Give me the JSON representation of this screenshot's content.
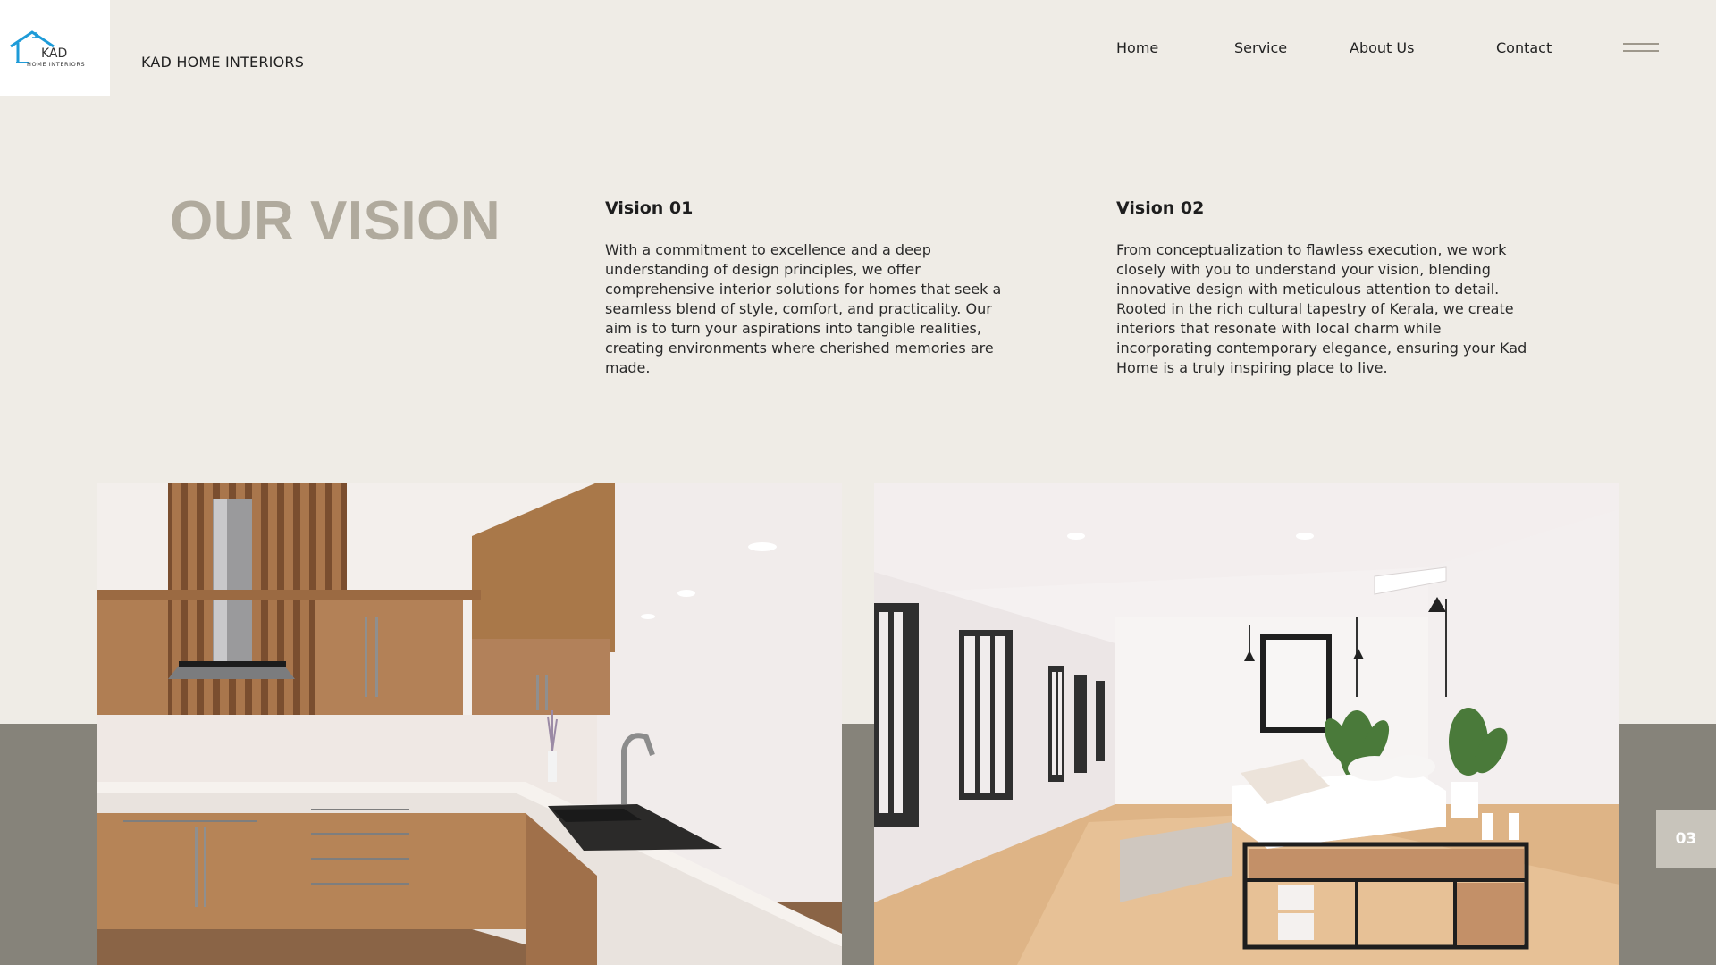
{
  "brand": {
    "logo_text_main": "KAD",
    "logo_text_sub": "HOME INTERIORS",
    "name": "KAD HOME INTERIORS"
  },
  "nav": {
    "items": [
      {
        "label": "Home"
      },
      {
        "label": "Service"
      },
      {
        "label": "About Us"
      },
      {
        "label": "Contact"
      }
    ],
    "menu_icon": "hamburger-icon"
  },
  "section": {
    "title": "OUR VISION",
    "visions": [
      {
        "heading": "Vision 01",
        "body": "With a commitment to excellence and a deep understanding of design principles, we offer comprehensive interior solutions for homes that seek a seamless blend of style, comfort, and practicality. Our aim is to turn your aspirations into tangible realities, creating environments where cherished memories are made."
      },
      {
        "heading": "Vision 02",
        "body": "From conceptualization to flawless execution, we work closely with you to understand your vision, blending innovative design with meticulous attention to detail. Rooted in the rich cultural tapestry of Kerala, we create interiors that resonate with local charm while incorporating contemporary elegance, ensuring your Kad Home is a truly inspiring place to live."
      }
    ]
  },
  "gallery": {
    "images": [
      "kitchen-photo",
      "bedroom-photo"
    ]
  },
  "page_indicator": "03",
  "colors": {
    "background": "#efece6",
    "band": "#86837a",
    "title": "#b0aa9d",
    "logo_accent": "#1e9bd8"
  }
}
